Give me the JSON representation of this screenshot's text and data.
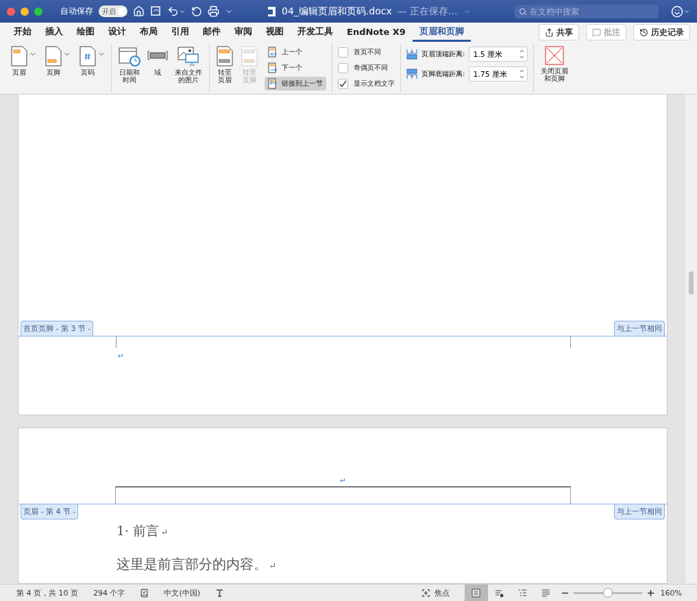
{
  "title_bar": {
    "autosave_label": "自动保存",
    "autosave_toggle": {
      "label": "开启",
      "on": true
    },
    "document_title": "04_编辑页眉和页码.docx",
    "save_status": "— 正在保存...",
    "search": {
      "placeholder": "在文档中搜索"
    }
  },
  "menu_tabs": [
    {
      "label": "开始",
      "selected": false
    },
    {
      "label": "插入",
      "selected": false
    },
    {
      "label": "绘图",
      "selected": false
    },
    {
      "label": "设计",
      "selected": false
    },
    {
      "label": "布局",
      "selected": false
    },
    {
      "label": "引用",
      "selected": false
    },
    {
      "label": "邮件",
      "selected": false
    },
    {
      "label": "审阅",
      "selected": false
    },
    {
      "label": "视图",
      "selected": false
    },
    {
      "label": "开发工具",
      "selected": false
    },
    {
      "label": "EndNote X9",
      "selected": false
    },
    {
      "label": "页眉和页脚",
      "selected": true
    }
  ],
  "header_buttons": [
    {
      "kind": "share",
      "label": "共享",
      "disabled": false
    },
    {
      "kind": "comment",
      "label": "批注",
      "disabled": true
    },
    {
      "kind": "history",
      "label": "历史记录",
      "disabled": false
    }
  ],
  "ribbon": {
    "insert_items": [
      {
        "kind": "header",
        "label": "页眉"
      },
      {
        "kind": "footer",
        "label": "页脚"
      },
      {
        "kind": "page-number",
        "label": "页码"
      }
    ],
    "object_items": [
      {
        "kind": "date",
        "label": "日期和时间"
      },
      {
        "kind": "field",
        "label": "域"
      },
      {
        "kind": "picture",
        "label": "来自文件的图片"
      }
    ],
    "goto_items": [
      {
        "label": "转至页眉",
        "disabled": false
      },
      {
        "label": "转至页脚",
        "disabled": true
      }
    ],
    "nav_items": [
      {
        "kind": "previous",
        "label": "上一个",
        "selected": false
      },
      {
        "kind": "next",
        "label": "下一个",
        "selected": false
      },
      {
        "kind": "link",
        "label": "链接到上一节",
        "selected": true
      }
    ],
    "options": [
      {
        "label": "首页不同",
        "checked": false
      },
      {
        "label": "奇偶页不同",
        "checked": false
      },
      {
        "label": "显示文档文字",
        "checked": true
      }
    ],
    "position": [
      {
        "kind": "top",
        "label": "页眉顶端距离:",
        "value": "1.5 厘米"
      },
      {
        "kind": "bottom",
        "label": "页脚底端距离:",
        "value": "1.75 厘米"
      }
    ],
    "close_label": "关闭页眉和页脚"
  },
  "pages": [
    {
      "footer_tag": "首页页脚 - 第 3 节 -",
      "same_tag": "与上一节相同",
      "paragraph_mark": "↵"
    },
    {
      "header_mark": "↵",
      "header_tag": "页眉 - 第 4 节 -",
      "same_tag": "与上一节相同",
      "paragraphs": [
        {
          "kind": "heading",
          "text": "1· 前言",
          "mark": "↵"
        },
        {
          "kind": "body",
          "text": "这里是前言部分的内容。",
          "mark": "↵"
        }
      ]
    }
  ],
  "status_bar": {
    "page": "第 4 页，共 10 页",
    "words": "294 个字",
    "language": "中文(中国)",
    "focus": "焦点",
    "zoom": {
      "level": 0.5,
      "reading": "160%"
    }
  }
}
